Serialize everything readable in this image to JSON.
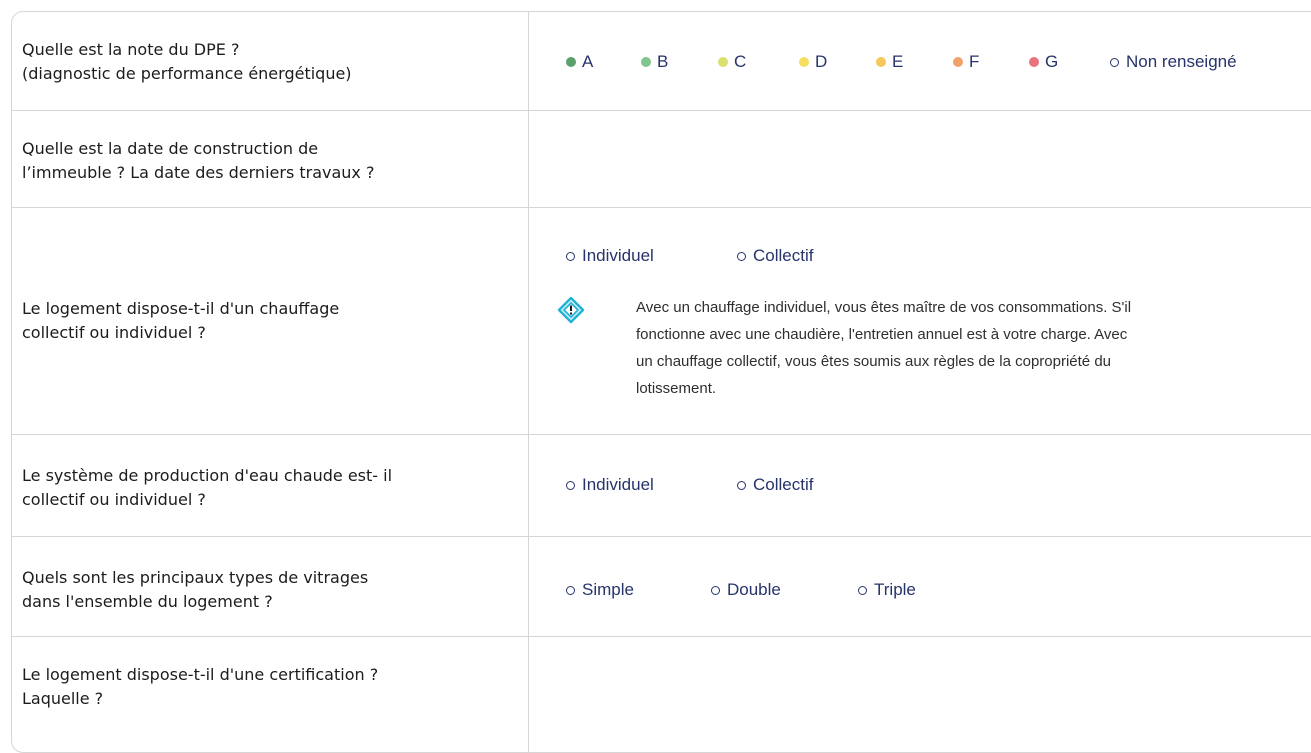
{
  "rows": [
    {
      "question_lines": [
        "Quelle est la note du DPE ?",
        "(diagnostic de performance énergétique)"
      ],
      "dpe_options": [
        {
          "label": "A",
          "color": "#5aa06b"
        },
        {
          "label": "B",
          "color": "#7fc58e"
        },
        {
          "label": "C",
          "color": "#d9e06c"
        },
        {
          "label": "D",
          "color": "#f6df5f"
        },
        {
          "label": "E",
          "color": "#f8c75a"
        },
        {
          "label": "F",
          "color": "#f1a16c"
        },
        {
          "label": "G",
          "color": "#e9737d"
        }
      ],
      "unknown_option": "Non renseigné"
    },
    {
      "question_lines": [
        "Quelle est la date de construction de",
        "l’immeuble ? La date des derniers travaux ?"
      ]
    },
    {
      "question_lines": [
        "Le logement dispose-t-il d'un chauffage",
        "collectif ou individuel ?"
      ],
      "options": [
        "Individuel",
        "Collectif"
      ],
      "note_lines": [
        "Avec un chauffage individuel, vous êtes maître de vos consommations. S'il",
        "fonctionne avec une chaudière, l'entretien annuel est à votre charge. Avec",
        "un chauffage collectif, vous êtes soumis aux règles de la copropriété du",
        "lotissement."
      ],
      "note_icon": "warning-diamond-icon"
    },
    {
      "question_lines": [
        "Le système de production d'eau chaude est- il",
        "collectif ou individuel ?"
      ],
      "options": [
        "Individuel",
        "Collectif"
      ]
    },
    {
      "question_lines": [
        "Quels sont les principaux types de vitrages",
        "dans l'ensemble du logement ?"
      ],
      "options": [
        "Simple",
        "Double",
        "Triple"
      ]
    },
    {
      "question_lines": [
        "Le logement dispose-t-il d'une certification ?",
        "Laquelle ?"
      ]
    }
  ],
  "colors": {
    "border": "#d6d6d6",
    "option_text": "#27336b",
    "accent_icon": "#21b3d6"
  }
}
